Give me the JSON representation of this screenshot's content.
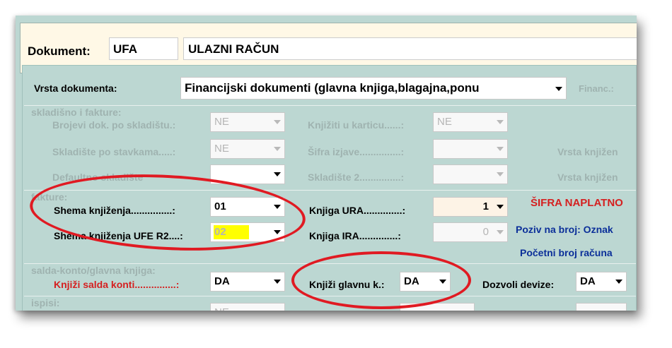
{
  "header": {
    "label": "Dokument:",
    "code": "UFA",
    "name": "ULAZNI RAČUN"
  },
  "vrsta": {
    "label": "Vrsta dokumenta:",
    "value": "Financijski dokumenti (glavna knjiga,blagajna,ponu",
    "right_label": "Financ.:"
  },
  "skladisno": {
    "section": "skladišno i fakture:",
    "brojevi_label": "Brojevi dok. po skladištu.:",
    "brojevi_value": "NE",
    "skladiste_label": "Skladište po stavkama.....:",
    "skladiste_value": "NE",
    "defaultno_label": "Defaultno skladište",
    "knjiziti_label": "Knjižiti u karticu......:",
    "knjiziti_value": "NE",
    "sifra_izjave_label": "Šifra izjave...............:",
    "skladiste2_label": "Skladište 2...............:",
    "vrsta_knjiz_1": "Vrsta knjižen",
    "vrsta_knjiz_2": "Vrsta knjižen"
  },
  "fakture": {
    "section": "fakture:",
    "shema_label": "Shema knjiženja...............:",
    "shema_value": "01",
    "shema_ufe_label": "Shema knjiženja UFE R2....:",
    "shema_ufe_value": "02",
    "knjiga_ura_label": "Knjiga URA..............:",
    "knjiga_ura_value": "1",
    "knjiga_ira_label": "Knjiga IRA..............:",
    "knjiga_ira_value": "0",
    "sifra_naplatno": "ŠIFRA NAPLATNO",
    "poziv": "Poziv na broj: Oznak",
    "pocetni": "Početni broj računa"
  },
  "salda": {
    "section": "salda-konto/glavna knjiga:",
    "knjizi_salda_label": "Knjiži salda konti...............:",
    "knjizi_salda_value": "DA",
    "knjizi_glavnu_label": "Knjiži glavnu k.:",
    "knjizi_glavnu_value": "DA",
    "dozvoli_label": "Dozvoli devize:",
    "dozvoli_value": "DA"
  },
  "ispisi": {
    "section": "ispisi:",
    "value": "NE"
  },
  "colors": {
    "panel": "#bcd7d2",
    "header": "#fff8e6",
    "highlight": "#ffff00",
    "annotation": "#e01a22"
  }
}
